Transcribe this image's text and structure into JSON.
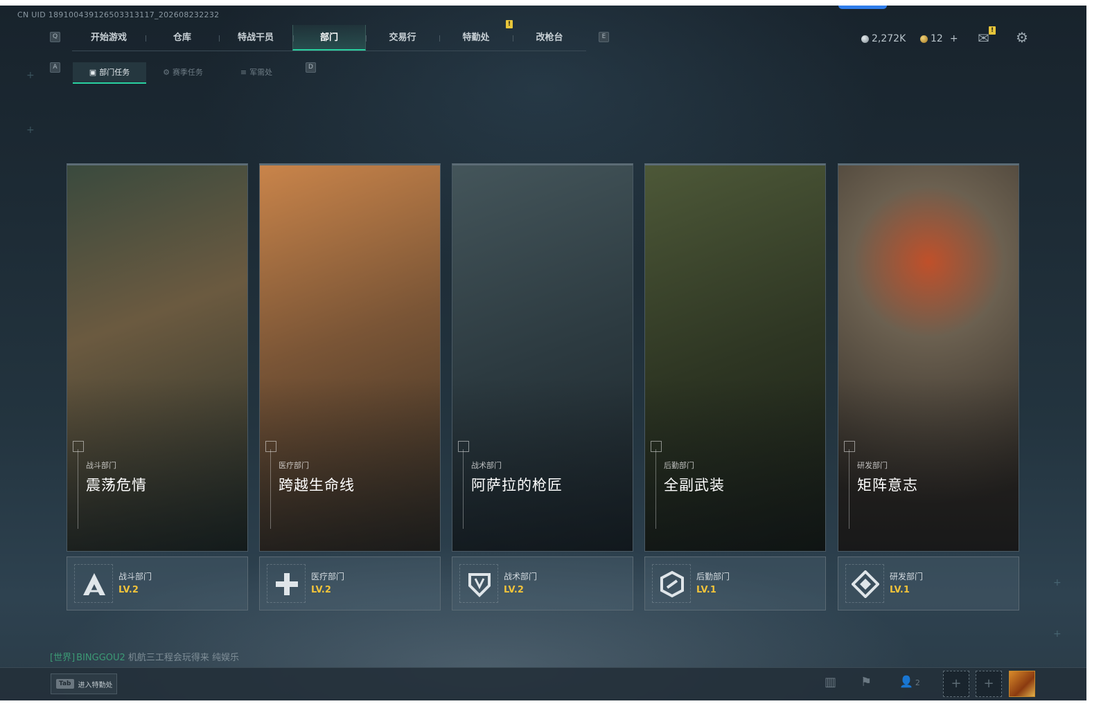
{
  "header": {
    "uid": "CN UID 18910043912650331311​7_202608232232",
    "nav_tabs": [
      "开始游戏",
      "仓库",
      "特战干员",
      "部门",
      "交易行",
      "特勤处",
      "改枪台"
    ],
    "active_tab": "部门",
    "left_key": "Q",
    "right_key": "E",
    "badge_text": "!",
    "currency_silver": "2,272K",
    "currency_gold": "12",
    "gold_add": "+"
  },
  "subnav": {
    "left_key": "A",
    "right_key": "D",
    "tabs": [
      "部门任务",
      "赛季任务",
      "军需处"
    ],
    "active": "部门任务"
  },
  "departments": [
    {
      "sub": "战斗部门",
      "title": "震荡危情",
      "name": "战斗部门",
      "level": "LV.2",
      "icon": "combat-emblem-icon",
      "colors": [
        "#3a4a3e",
        "#6b5a40",
        "#1f2a25"
      ]
    },
    {
      "sub": "医疗部门",
      "title": "跨越生命线",
      "name": "医疗部门",
      "level": "LV.2",
      "icon": "medical-cross-icon",
      "colors": [
        "#c9844a",
        "#7a5536",
        "#2f2a22"
      ]
    },
    {
      "sub": "战术部门",
      "title": "阿萨拉的枪匠",
      "name": "战术部门",
      "level": "LV.2",
      "icon": "tactical-shield-icon",
      "colors": [
        "#44555a",
        "#2c3a40",
        "#1a2328"
      ]
    },
    {
      "sub": "后勤部门",
      "title": "全副武装",
      "name": "后勤部门",
      "level": "LV.1",
      "icon": "logistics-hex-icon",
      "colors": [
        "#4d5838",
        "#2e3623",
        "#161b14"
      ]
    },
    {
      "sub": "研发部门",
      "title": "矩阵意志",
      "name": "研发部门",
      "level": "LV.1",
      "icon": "research-diamond-icon",
      "colors": [
        "#6b6050",
        "#c0502a",
        "#2a2520"
      ]
    }
  ],
  "chat": {
    "channel": "[世界]",
    "name": "BINGGOU2",
    "message": "机航三工程会玩得来  纯娱乐"
  },
  "bottom": {
    "tab_key": "Tab",
    "tab_label": "进入特勤处",
    "squad_count": "2"
  }
}
